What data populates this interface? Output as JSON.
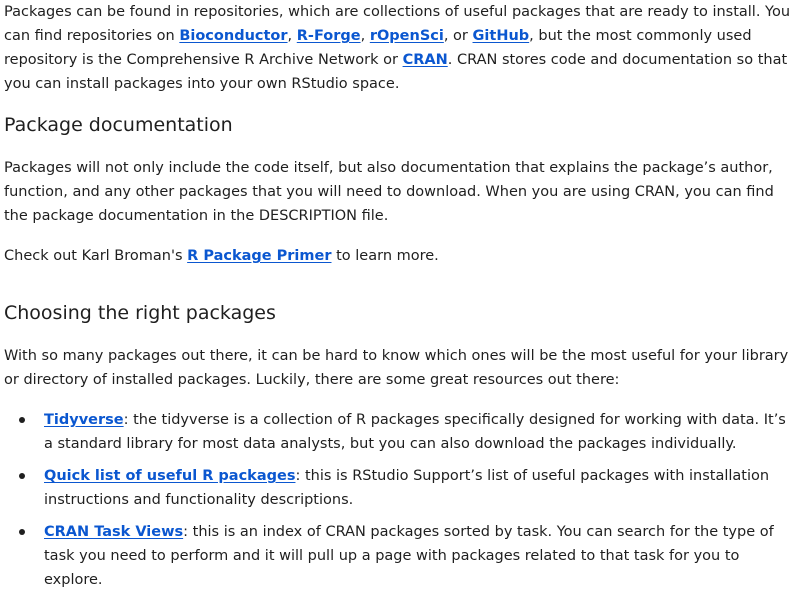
{
  "intro": {
    "t1": "Packages can be found in repositories, which are collections of useful packages that are ready to install. You can find repositories on ",
    "link_bioconductor": "Bioconductor",
    "sep1": ", ",
    "link_rforge": "R-Forge",
    "sep2": ", ",
    "link_ropensci": "rOpenSci",
    "sep3": ", or ",
    "link_github": "GitHub",
    "t2": ", but the most commonly used repository is the Comprehensive R Archive Network or ",
    "link_cran": "CRAN",
    "t3": ". CRAN stores code and documentation so that you can install packages into your own RStudio space."
  },
  "section_doc": {
    "heading": "Package documentation",
    "paragraph": "Packages will not only include the code itself, but also documentation that explains the package’s author, function, and any other packages that you will need to download. When you are using CRAN, you can find the package documentation in the DESCRIPTION file.",
    "primer_before": "Check out Karl Broman's ",
    "primer_link": "R Package Primer",
    "primer_after": " to learn more."
  },
  "section_choose": {
    "heading": "Choosing the right packages",
    "paragraph": "With so many packages out there, it can be hard to know which ones will be the most useful for your library or directory of installed packages. Luckily, there are some great resources out there:",
    "items": [
      {
        "link": "Tidyverse",
        "text": ": the tidyverse is a collection of R packages specifically designed for working with data. It’s a standard library for most data analysts, but you can also download the packages individually."
      },
      {
        "link": "Quick list of useful R packages",
        "text": ": this is RStudio Support’s list of useful packages with installation instructions and functionality descriptions."
      },
      {
        "link": "CRAN Task Views",
        "text": ": this is an index of CRAN packages sorted by task. You can search for the type of task you need to perform and it will pull up a page with packages related to that task for you to explore."
      }
    ]
  }
}
